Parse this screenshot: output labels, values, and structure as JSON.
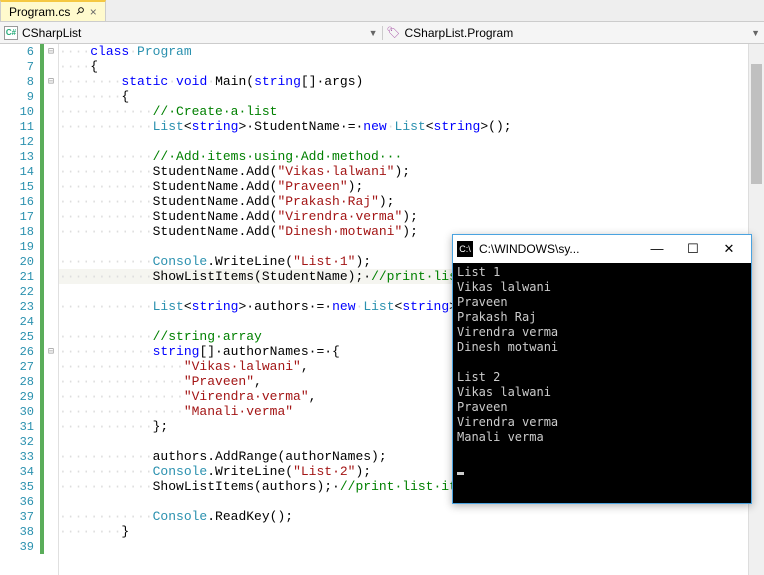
{
  "tab": {
    "name": "Program.cs",
    "close_glyph": "×",
    "pin_glyph": "📌"
  },
  "nav": {
    "left_label": "CSharpList",
    "right_label": "CSharpList.Program",
    "cs_icon_text": "C#"
  },
  "line_numbers": [
    "6",
    "7",
    "8",
    "9",
    "10",
    "11",
    "12",
    "13",
    "14",
    "15",
    "16",
    "17",
    "18",
    "19",
    "20",
    "21",
    "22",
    "23",
    "24",
    "25",
    "26",
    "27",
    "28",
    "29",
    "30",
    "31",
    "32",
    "33",
    "34",
    "35",
    "36",
    "37",
    "38",
    "39"
  ],
  "fold_rows": {
    "0": "⊟",
    "2": "⊟",
    "20": "⊟"
  },
  "code": {
    "l6": {
      "ws": "····",
      "kw1": "class",
      "sp": "·",
      "type": "Program"
    },
    "l7": {
      "ws": "····",
      "txt": "{"
    },
    "l8": {
      "ws": "········",
      "kw1": "static",
      "sp1": "·",
      "kw2": "void",
      "sp2": "·",
      "id": "Main(",
      "kw3": "string",
      "rest": "[]·args)"
    },
    "l9": {
      "ws": "········",
      "txt": "{"
    },
    "l10": {
      "ws": "············",
      "cmt": "//·Create·a·list"
    },
    "l11": {
      "ws": "············",
      "type1": "List",
      "lt": "<",
      "kw": "string",
      "gt": ">·",
      "id": "StudentName·=·",
      "kw2": "new",
      "sp": "·",
      "type2": "List",
      "lt2": "<",
      "kw3": "string",
      "rest": ">();"
    },
    "l12": {
      "ws": ""
    },
    "l13": {
      "ws": "············",
      "cmt": "//·Add·items·using·Add·method···"
    },
    "l14": {
      "ws": "············",
      "id": "StudentName.Add(",
      "str": "\"Vikas·lalwani\"",
      "rest": ");"
    },
    "l15": {
      "ws": "············",
      "id": "StudentName.Add(",
      "str": "\"Praveen\"",
      "rest": ");"
    },
    "l16": {
      "ws": "············",
      "id": "StudentName.Add(",
      "str": "\"Prakash·Raj\"",
      "rest": ");"
    },
    "l17": {
      "ws": "············",
      "id": "StudentName.Add(",
      "str": "\"Virendra·verma\"",
      "rest": ");"
    },
    "l18": {
      "ws": "············",
      "id": "StudentName.Add(",
      "str": "\"Dinesh·motwani\"",
      "rest": ");"
    },
    "l19": {
      "ws": ""
    },
    "l20": {
      "ws": "············",
      "type": "Console",
      "id": ".WriteLine(",
      "str": "\"List·1\"",
      "rest": ");"
    },
    "l21": {
      "ws": "············",
      "id": "ShowListItems(StudentName);·",
      "cmt": "//print·list·items"
    },
    "l22": {
      "ws": ""
    },
    "l23": {
      "ws": "············",
      "type1": "List",
      "lt": "<",
      "kw": "string",
      "gt": ">·",
      "id": "authors·=·",
      "kw2": "new",
      "sp": "·",
      "type2": "List",
      "lt2": "<",
      "kw3": "string",
      "rest": ">();"
    },
    "l24": {
      "ws": ""
    },
    "l25": {
      "ws": "············",
      "cmt": "//string·array"
    },
    "l26": {
      "ws": "············",
      "kw": "string",
      "id": "[]·authorNames·=·{"
    },
    "l27": {
      "ws": "················",
      "str": "\"Vikas·lalwani\"",
      "rest": ","
    },
    "l28": {
      "ws": "················",
      "str": "\"Praveen\"",
      "rest": ","
    },
    "l29": {
      "ws": "················",
      "str": "\"Virendra·verma\"",
      "rest": ","
    },
    "l30": {
      "ws": "················",
      "str": "\"Manali·verma\""
    },
    "l31": {
      "ws": "············",
      "txt": "};"
    },
    "l32": {
      "ws": ""
    },
    "l33": {
      "ws": "············",
      "id": "authors.AddRange(authorNames);"
    },
    "l34": {
      "ws": "············",
      "type": "Console",
      "id": ".WriteLine(",
      "str": "\"List·2\"",
      "rest": ");"
    },
    "l35": {
      "ws": "············",
      "id": "ShowListItems(authors);·",
      "cmt": "//print·list·items"
    },
    "l36": {
      "ws": ""
    },
    "l37": {
      "ws": "············",
      "type": "Console",
      "id": ".ReadKey();"
    },
    "l38": {
      "ws": "········",
      "txt": "}"
    },
    "l39": {
      "ws": ""
    }
  },
  "console": {
    "icon_text": "C:\\",
    "title": "C:\\WINDOWS\\sy...",
    "min": "—",
    "max": "☐",
    "close": "✕",
    "lines": [
      "List 1",
      "Vikas lalwani",
      "Praveen",
      "Prakash Raj",
      "Virendra verma",
      "Dinesh motwani",
      "",
      "List 2",
      "Vikas lalwani",
      "Praveen",
      "Virendra verma",
      "Manali verma",
      ""
    ]
  }
}
